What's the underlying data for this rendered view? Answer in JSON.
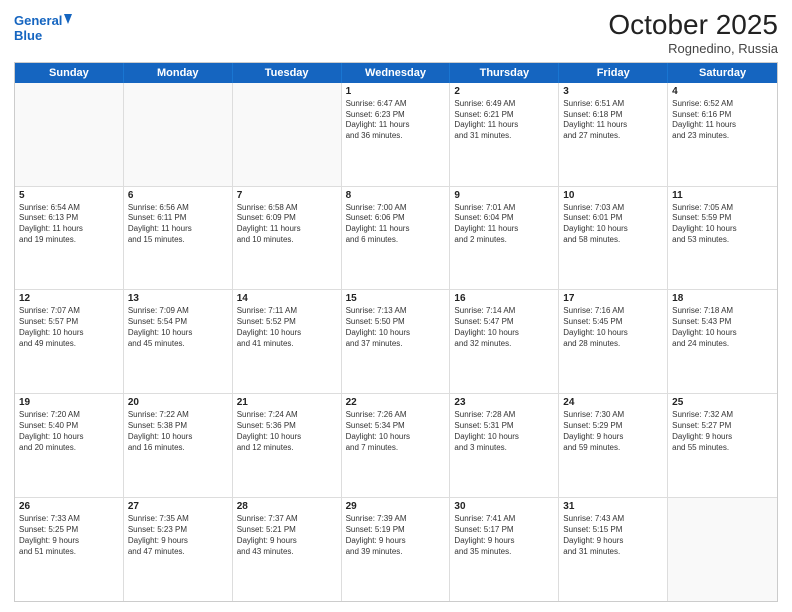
{
  "header": {
    "logo_line1": "General",
    "logo_line2": "Blue",
    "month": "October 2025",
    "location": "Rognedino, Russia"
  },
  "weekdays": [
    "Sunday",
    "Monday",
    "Tuesday",
    "Wednesday",
    "Thursday",
    "Friday",
    "Saturday"
  ],
  "rows": [
    [
      {
        "day": "",
        "text": "",
        "empty": true
      },
      {
        "day": "",
        "text": "",
        "empty": true
      },
      {
        "day": "",
        "text": "",
        "empty": true
      },
      {
        "day": "1",
        "text": "Sunrise: 6:47 AM\nSunset: 6:23 PM\nDaylight: 11 hours\nand 36 minutes."
      },
      {
        "day": "2",
        "text": "Sunrise: 6:49 AM\nSunset: 6:21 PM\nDaylight: 11 hours\nand 31 minutes."
      },
      {
        "day": "3",
        "text": "Sunrise: 6:51 AM\nSunset: 6:18 PM\nDaylight: 11 hours\nand 27 minutes."
      },
      {
        "day": "4",
        "text": "Sunrise: 6:52 AM\nSunset: 6:16 PM\nDaylight: 11 hours\nand 23 minutes."
      }
    ],
    [
      {
        "day": "5",
        "text": "Sunrise: 6:54 AM\nSunset: 6:13 PM\nDaylight: 11 hours\nand 19 minutes."
      },
      {
        "day": "6",
        "text": "Sunrise: 6:56 AM\nSunset: 6:11 PM\nDaylight: 11 hours\nand 15 minutes."
      },
      {
        "day": "7",
        "text": "Sunrise: 6:58 AM\nSunset: 6:09 PM\nDaylight: 11 hours\nand 10 minutes."
      },
      {
        "day": "8",
        "text": "Sunrise: 7:00 AM\nSunset: 6:06 PM\nDaylight: 11 hours\nand 6 minutes."
      },
      {
        "day": "9",
        "text": "Sunrise: 7:01 AM\nSunset: 6:04 PM\nDaylight: 11 hours\nand 2 minutes."
      },
      {
        "day": "10",
        "text": "Sunrise: 7:03 AM\nSunset: 6:01 PM\nDaylight: 10 hours\nand 58 minutes."
      },
      {
        "day": "11",
        "text": "Sunrise: 7:05 AM\nSunset: 5:59 PM\nDaylight: 10 hours\nand 53 minutes."
      }
    ],
    [
      {
        "day": "12",
        "text": "Sunrise: 7:07 AM\nSunset: 5:57 PM\nDaylight: 10 hours\nand 49 minutes."
      },
      {
        "day": "13",
        "text": "Sunrise: 7:09 AM\nSunset: 5:54 PM\nDaylight: 10 hours\nand 45 minutes."
      },
      {
        "day": "14",
        "text": "Sunrise: 7:11 AM\nSunset: 5:52 PM\nDaylight: 10 hours\nand 41 minutes."
      },
      {
        "day": "15",
        "text": "Sunrise: 7:13 AM\nSunset: 5:50 PM\nDaylight: 10 hours\nand 37 minutes."
      },
      {
        "day": "16",
        "text": "Sunrise: 7:14 AM\nSunset: 5:47 PM\nDaylight: 10 hours\nand 32 minutes."
      },
      {
        "day": "17",
        "text": "Sunrise: 7:16 AM\nSunset: 5:45 PM\nDaylight: 10 hours\nand 28 minutes."
      },
      {
        "day": "18",
        "text": "Sunrise: 7:18 AM\nSunset: 5:43 PM\nDaylight: 10 hours\nand 24 minutes."
      }
    ],
    [
      {
        "day": "19",
        "text": "Sunrise: 7:20 AM\nSunset: 5:40 PM\nDaylight: 10 hours\nand 20 minutes."
      },
      {
        "day": "20",
        "text": "Sunrise: 7:22 AM\nSunset: 5:38 PM\nDaylight: 10 hours\nand 16 minutes."
      },
      {
        "day": "21",
        "text": "Sunrise: 7:24 AM\nSunset: 5:36 PM\nDaylight: 10 hours\nand 12 minutes."
      },
      {
        "day": "22",
        "text": "Sunrise: 7:26 AM\nSunset: 5:34 PM\nDaylight: 10 hours\nand 7 minutes."
      },
      {
        "day": "23",
        "text": "Sunrise: 7:28 AM\nSunset: 5:31 PM\nDaylight: 10 hours\nand 3 minutes."
      },
      {
        "day": "24",
        "text": "Sunrise: 7:30 AM\nSunset: 5:29 PM\nDaylight: 9 hours\nand 59 minutes."
      },
      {
        "day": "25",
        "text": "Sunrise: 7:32 AM\nSunset: 5:27 PM\nDaylight: 9 hours\nand 55 minutes."
      }
    ],
    [
      {
        "day": "26",
        "text": "Sunrise: 7:33 AM\nSunset: 5:25 PM\nDaylight: 9 hours\nand 51 minutes."
      },
      {
        "day": "27",
        "text": "Sunrise: 7:35 AM\nSunset: 5:23 PM\nDaylight: 9 hours\nand 47 minutes."
      },
      {
        "day": "28",
        "text": "Sunrise: 7:37 AM\nSunset: 5:21 PM\nDaylight: 9 hours\nand 43 minutes."
      },
      {
        "day": "29",
        "text": "Sunrise: 7:39 AM\nSunset: 5:19 PM\nDaylight: 9 hours\nand 39 minutes."
      },
      {
        "day": "30",
        "text": "Sunrise: 7:41 AM\nSunset: 5:17 PM\nDaylight: 9 hours\nand 35 minutes."
      },
      {
        "day": "31",
        "text": "Sunrise: 7:43 AM\nSunset: 5:15 PM\nDaylight: 9 hours\nand 31 minutes."
      },
      {
        "day": "",
        "text": "",
        "empty": true
      }
    ]
  ]
}
